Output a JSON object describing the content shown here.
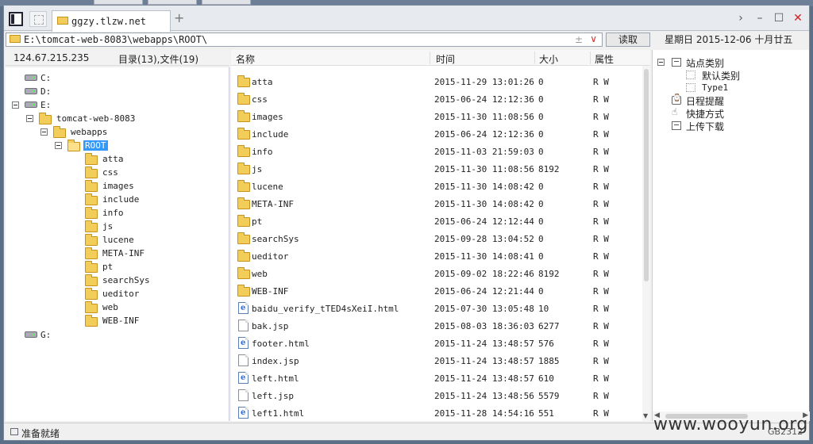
{
  "tabbar": {
    "tab_label": "ggzy.tlzw.net",
    "add_tab": "+",
    "controls": {
      "more": "›",
      "minimize": "–",
      "maximize": "☐",
      "close": "✕"
    }
  },
  "address": {
    "path": "E:\\tomcat-web-8083\\webapps\\ROOT\\",
    "plusminus": "±",
    "dropdown": "∨",
    "read_button": "读取",
    "date": "星期日 2015-12-06 十月廿五"
  },
  "left_header": {
    "ip": "124.67.215.235",
    "counts": "目录(13),文件(19)"
  },
  "tree": {
    "drive_c": "C:",
    "drive_d": "D:",
    "drive_e": "E:",
    "tomcat": "tomcat-web-8083",
    "webapps": "webapps",
    "root": "ROOT",
    "children": [
      "atta",
      "css",
      "images",
      "include",
      "info",
      "js",
      "lucene",
      "META-INF",
      "pt",
      "searchSys",
      "ueditor",
      "web",
      "WEB-INF"
    ],
    "drive_g": "G:"
  },
  "list": {
    "headers": {
      "name": "名称",
      "time": "时间",
      "size": "大小",
      "attr": "属性"
    },
    "rows": [
      {
        "type": "folder",
        "name": "atta",
        "time": "2015-11-29 13:01:26",
        "size": "0",
        "attr": "R W"
      },
      {
        "type": "folder",
        "name": "css",
        "time": "2015-06-24 12:12:36",
        "size": "0",
        "attr": "R W"
      },
      {
        "type": "folder",
        "name": "images",
        "time": "2015-11-30 11:08:56",
        "size": "0",
        "attr": "R W"
      },
      {
        "type": "folder",
        "name": "include",
        "time": "2015-06-24 12:12:36",
        "size": "0",
        "attr": "R W"
      },
      {
        "type": "folder",
        "name": "info",
        "time": "2015-11-03 21:59:03",
        "size": "0",
        "attr": "R W"
      },
      {
        "type": "folder",
        "name": "js",
        "time": "2015-11-30 11:08:56",
        "size": "8192",
        "attr": "R W"
      },
      {
        "type": "folder",
        "name": "lucene",
        "time": "2015-11-30 14:08:42",
        "size": "0",
        "attr": "R W"
      },
      {
        "type": "folder",
        "name": "META-INF",
        "time": "2015-11-30 14:08:42",
        "size": "0",
        "attr": "R W"
      },
      {
        "type": "folder",
        "name": "pt",
        "time": "2015-06-24 12:12:44",
        "size": "0",
        "attr": "R W"
      },
      {
        "type": "folder",
        "name": "searchSys",
        "time": "2015-09-28 13:04:52",
        "size": "0",
        "attr": "R W"
      },
      {
        "type": "folder",
        "name": "ueditor",
        "time": "2015-11-30 14:08:41",
        "size": "0",
        "attr": "R W"
      },
      {
        "type": "folder",
        "name": "web",
        "time": "2015-09-02 18:22:46",
        "size": "8192",
        "attr": "R W"
      },
      {
        "type": "folder",
        "name": "WEB-INF",
        "time": "2015-06-24 12:21:44",
        "size": "0",
        "attr": "R W"
      },
      {
        "type": "html",
        "name": "baidu_verify_tTED4sXeiI.html",
        "time": "2015-07-30 13:05:48",
        "size": "10",
        "attr": "R W"
      },
      {
        "type": "file",
        "name": "bak.jsp",
        "time": "2015-08-03 18:36:03",
        "size": "6277",
        "attr": "R W"
      },
      {
        "type": "html",
        "name": "footer.html",
        "time": "2015-11-24 13:48:57",
        "size": "576",
        "attr": "R W"
      },
      {
        "type": "file",
        "name": "index.jsp",
        "time": "2015-11-24 13:48:57",
        "size": "1885",
        "attr": "R W"
      },
      {
        "type": "html",
        "name": "left.html",
        "time": "2015-11-24 13:48:57",
        "size": "610",
        "attr": "R W"
      },
      {
        "type": "file",
        "name": "left.jsp",
        "time": "2015-11-24 13:48:56",
        "size": "5579",
        "attr": "R W"
      },
      {
        "type": "html",
        "name": "left1.html",
        "time": "2015-11-28 14:54:16",
        "size": "551",
        "attr": "R W"
      }
    ]
  },
  "right_tree": {
    "site_category": "站点类别",
    "default_category": "默认类别",
    "type1": "Type1",
    "schedule": "日程提醒",
    "shortcut": "快捷方式",
    "upload_download": "上传下载"
  },
  "status": {
    "ready": "准备就绪",
    "encoding": "GB2312",
    "watermark": "www.wooyun.org"
  }
}
